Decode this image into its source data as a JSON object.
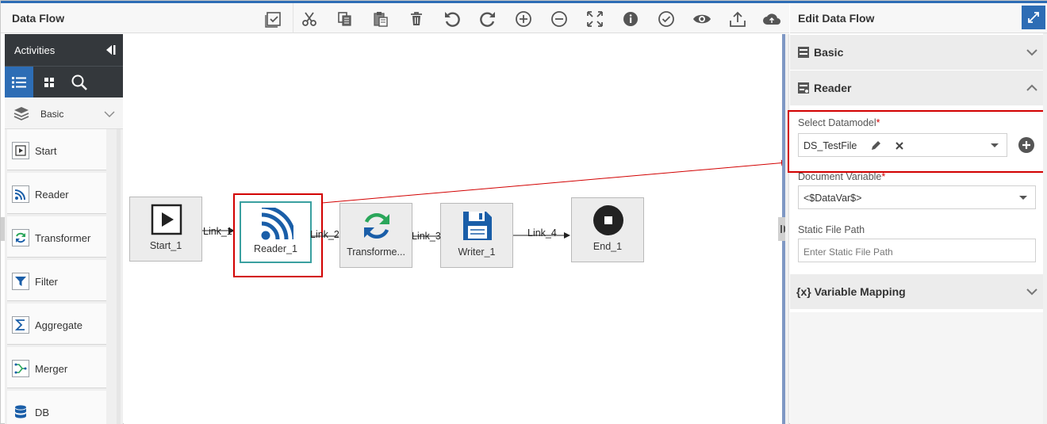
{
  "header": {
    "title": "Data Flow",
    "toolbar": [
      {
        "name": "validate-icon"
      },
      {
        "name": "cut-icon"
      },
      {
        "name": "copy-icon"
      },
      {
        "name": "paste-icon"
      },
      {
        "name": "delete-icon"
      },
      {
        "name": "undo-icon"
      },
      {
        "name": "redo-icon"
      },
      {
        "name": "zoom-in-icon"
      },
      {
        "name": "zoom-out-icon"
      },
      {
        "name": "fit-screen-icon"
      },
      {
        "name": "info-icon"
      },
      {
        "name": "check-circle-icon"
      },
      {
        "name": "preview-eye-icon"
      },
      {
        "name": "upload-icon"
      },
      {
        "name": "cloud-icon"
      }
    ]
  },
  "palette": {
    "title": "Activities",
    "category": "Basic",
    "items": [
      {
        "label": "Start",
        "icon": "play-icon"
      },
      {
        "label": "Reader",
        "icon": "rss-icon"
      },
      {
        "label": "Transformer",
        "icon": "refresh-icon"
      },
      {
        "label": "Filter",
        "icon": "filter-icon"
      },
      {
        "label": "Aggregate",
        "icon": "sigma-icon"
      },
      {
        "label": "Merger",
        "icon": "merge-icon"
      },
      {
        "label": "DB",
        "icon": "database-icon"
      }
    ]
  },
  "canvas": {
    "nodes": [
      {
        "label": "Start_1"
      },
      {
        "label": "Reader_1"
      },
      {
        "label": "Transforme..."
      },
      {
        "label": "Writer_1"
      },
      {
        "label": "End_1"
      }
    ],
    "links": [
      "Link_1",
      "Link_2",
      "Link_3",
      "Link_4"
    ]
  },
  "panel": {
    "title": "Edit Data Flow",
    "sections": {
      "basic": "Basic",
      "reader": "Reader",
      "variable_mapping": "{x} Variable Mapping"
    },
    "fields": {
      "datamodel_label": "Select Datamodel",
      "datamodel_value": "DS_TestFile",
      "docvar_label": "Document Variable",
      "docvar_value": "<$DataVar$>",
      "static_path_label": "Static File Path",
      "static_path_placeholder": "Enter Static File Path"
    },
    "required_mark": "*"
  },
  "colors": {
    "accent": "#2d6db5",
    "highlight": "#d20000",
    "reader_icon": "#1a5ea8",
    "transformer_icon": "#2aa65a"
  }
}
